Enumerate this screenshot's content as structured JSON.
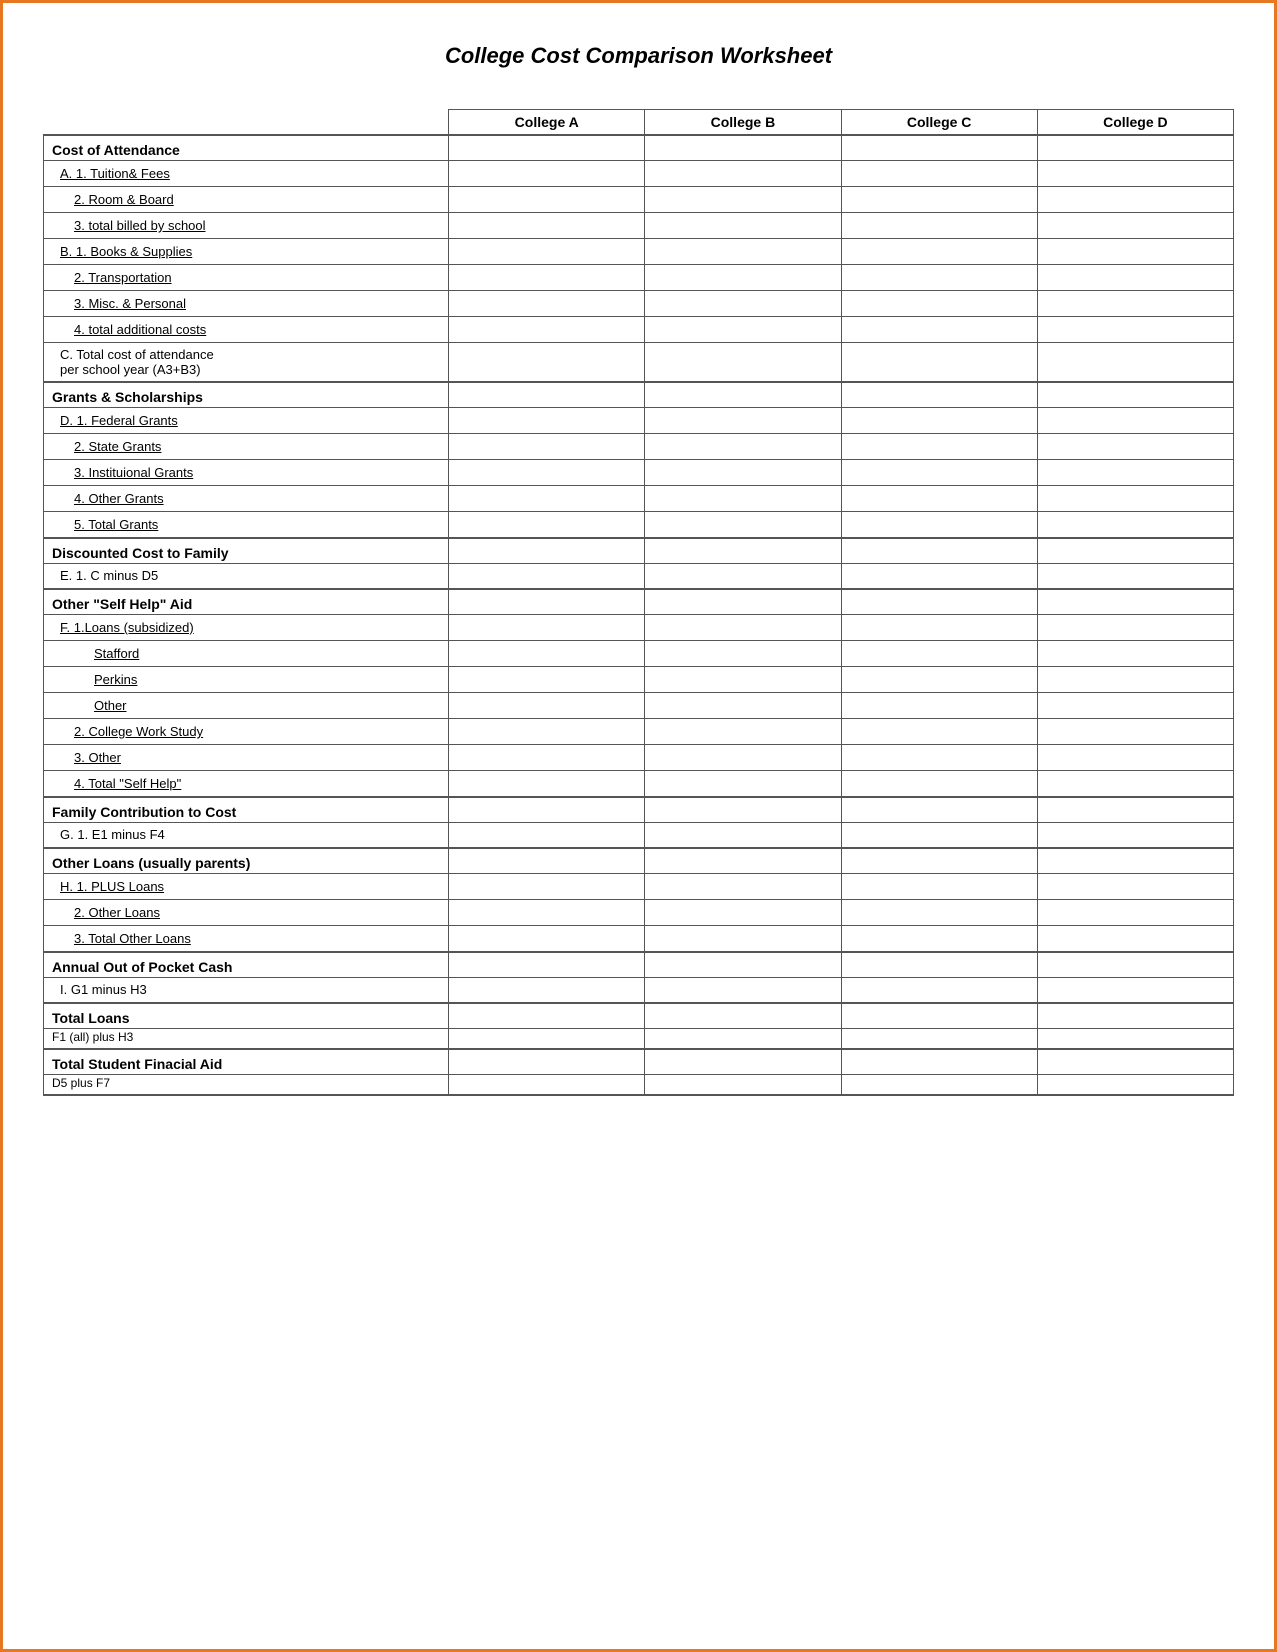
{
  "title": "College Cost Comparison Worksheet",
  "columns": {
    "label": "",
    "college_a": "College A",
    "college_b": "College B",
    "college_c": "College C",
    "college_d": "College D"
  },
  "sections": [
    {
      "id": "cost-of-attendance",
      "header": "Cost of Attendance",
      "sub_header": null,
      "rows": [
        {
          "label": "A.  1. Tuition& Fees",
          "indent": 0,
          "underline": true
        },
        {
          "label": "2. Room & Board",
          "indent": 1,
          "underline": true
        },
        {
          "label": "3. total billed by school",
          "indent": 1,
          "underline": true
        },
        {
          "label": "B.  1. Books & Supplies",
          "indent": 0,
          "underline": true
        },
        {
          "label": "2. Transportation",
          "indent": 1,
          "underline": true
        },
        {
          "label": "3. Misc. & Personal",
          "indent": 1,
          "underline": true
        },
        {
          "label": "4. total additional costs",
          "indent": 1,
          "underline": true
        },
        {
          "label": "C.  Total cost of attendance per school year (A3+B3)",
          "indent": 0,
          "underline": false,
          "two_line": true
        }
      ]
    },
    {
      "id": "grants-scholarships",
      "header": "Grants & Scholarships",
      "sub_header": null,
      "rows": [
        {
          "label": "D.  1. Federal Grants",
          "indent": 0,
          "underline": true
        },
        {
          "label": "2. State Grants",
          "indent": 1,
          "underline": true
        },
        {
          "label": "3. Instituional Grants",
          "indent": 1,
          "underline": true
        },
        {
          "label": "4. Other Grants",
          "indent": 1,
          "underline": true
        },
        {
          "label": "5. Total Grants",
          "indent": 1,
          "underline": true
        }
      ]
    },
    {
      "id": "discounted-cost",
      "header": "Discounted Cost to Family",
      "sub_header": null,
      "rows": [
        {
          "label": "E.  1. C minus D5",
          "indent": 0,
          "underline": false
        }
      ]
    },
    {
      "id": "self-help-aid",
      "header": "Other \"Self Help\" Aid",
      "sub_header": null,
      "rows": [
        {
          "label": "F.   1.Loans (subsidized)",
          "indent": 0,
          "underline": true
        },
        {
          "label": "Stafford",
          "indent": 2,
          "underline": true
        },
        {
          "label": "Perkins",
          "indent": 2,
          "underline": true
        },
        {
          "label": "Other",
          "indent": 2,
          "underline": true
        },
        {
          "label": "2. College Work Study",
          "indent": 1,
          "underline": true
        },
        {
          "label": "3. Other",
          "indent": 1,
          "underline": true
        },
        {
          "label": "4. Total \"Self Help\"",
          "indent": 1,
          "underline": true
        }
      ]
    },
    {
      "id": "family-contribution",
      "header": "Family Contribution to Cost",
      "sub_header": null,
      "rows": [
        {
          "label": "G.  1. E1 minus F4",
          "indent": 0,
          "underline": false
        }
      ]
    },
    {
      "id": "other-loans",
      "header": "Other Loans (usually parents)",
      "sub_header": null,
      "rows": [
        {
          "label": "H.  1. PLUS Loans",
          "indent": 0,
          "underline": true
        },
        {
          "label": "2. Other Loans",
          "indent": 1,
          "underline": true
        },
        {
          "label": "3. Total Other Loans",
          "indent": 1,
          "underline": true
        }
      ]
    },
    {
      "id": "annual-out-of-pocket",
      "header": "Annual Out of Pocket Cash",
      "sub_header": null,
      "rows": [
        {
          "label": "I.   G1 minus H3",
          "indent": 0,
          "underline": false
        }
      ]
    },
    {
      "id": "total-loans",
      "header": "Total Loans",
      "sub_header": "F1 (all) plus H3",
      "rows": []
    },
    {
      "id": "total-student-aid",
      "header": "Total Student Finacial Aid",
      "sub_header": "D5 plus F7",
      "rows": []
    }
  ]
}
